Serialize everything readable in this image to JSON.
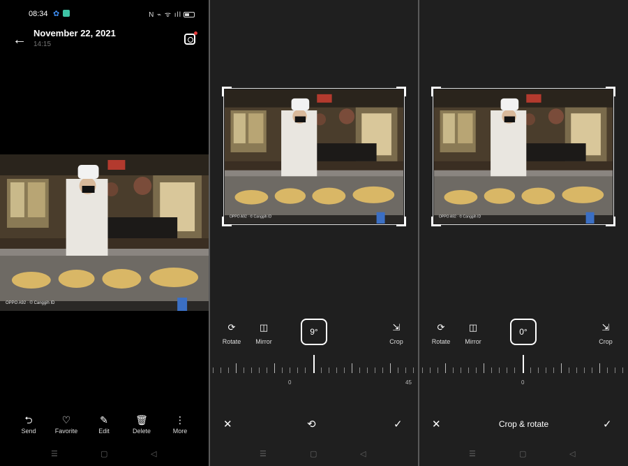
{
  "status": {
    "time": "08:34",
    "right_icons": "N ⌁ ᯤ ıll"
  },
  "header": {
    "date": "November 22, 2021",
    "time": "14:15"
  },
  "photo": {
    "watermark": "OPPO A92 · © Canggih ID"
  },
  "actions": [
    {
      "label": "Send",
      "icon": "share-icon"
    },
    {
      "label": "Favorite",
      "icon": "heart-icon"
    },
    {
      "label": "Edit",
      "icon": "edit-icon"
    },
    {
      "label": "Delete",
      "icon": "trash-icon"
    },
    {
      "label": "More",
      "icon": "more-icon"
    }
  ],
  "editor_a": {
    "rotate_label": "Rotate",
    "mirror_label": "Mirror",
    "crop_label": "Crop",
    "angle": "9°",
    "ruler_labels": [
      "0",
      "45"
    ]
  },
  "editor_b": {
    "rotate_label": "Rotate",
    "mirror_label": "Mirror",
    "crop_label": "Crop",
    "angle": "0°",
    "ruler_labels": [
      "0"
    ],
    "title": "Crop & rotate"
  },
  "colors": {
    "background": "#000000",
    "editor_bg": "#1f1f1f",
    "accent": "#ffffff"
  }
}
